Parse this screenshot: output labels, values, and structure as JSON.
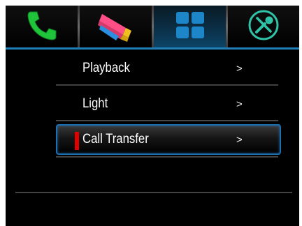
{
  "tabs": [
    {
      "icon": "phone-icon",
      "color": "#1fc43a",
      "active": false
    },
    {
      "icon": "cctv-camera-icon",
      "color": "#ff4f86",
      "active": false
    },
    {
      "icon": "grid-menu-icon",
      "color": "#1c86c8",
      "active": true
    },
    {
      "icon": "tools-settings-icon",
      "color": "#2fc4a8",
      "active": false
    }
  ],
  "menu": {
    "items": [
      {
        "label": "Playback",
        "arrow": ">"
      },
      {
        "label": "Light",
        "arrow": ">"
      },
      {
        "label": "Call Transfer",
        "arrow": ">",
        "selected": true
      }
    ]
  },
  "colors": {
    "background": "#000000",
    "accent": "#1f7fb8",
    "selection_marker": "#e00000"
  }
}
